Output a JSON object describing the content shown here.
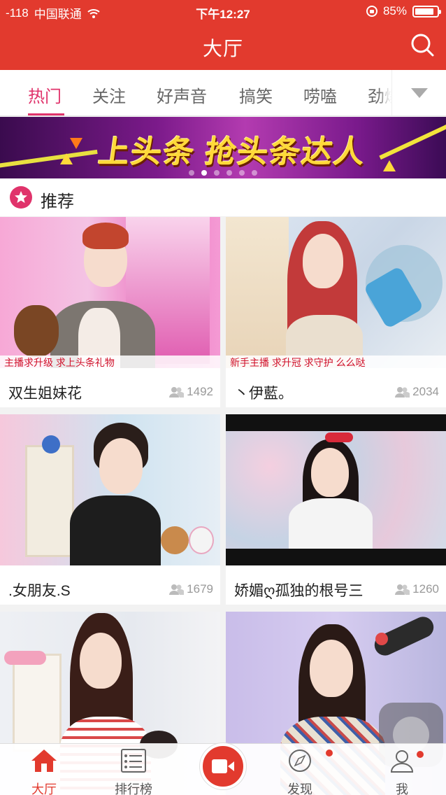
{
  "status_bar": {
    "signal": "-118",
    "carrier": "中国联通",
    "time": "下午12:27",
    "battery": "85%",
    "battery_level": 0.85
  },
  "nav": {
    "title": "大厅",
    "search_icon": "search-icon"
  },
  "tabs": [
    {
      "label": "热门",
      "active": true
    },
    {
      "label": "关注"
    },
    {
      "label": "好声音"
    },
    {
      "label": "搞笑"
    },
    {
      "label": "唠嗑"
    },
    {
      "label": "劲爆"
    }
  ],
  "banner": {
    "text": "上头条 抢头条达人",
    "slides": 6,
    "active_slide": 1
  },
  "section": {
    "title": "推荐",
    "icon": "star-icon"
  },
  "cards": [
    {
      "name": "双生姐妹花",
      "viewers": "1492",
      "overlay": "主播求升级  求上头条礼物"
    },
    {
      "name": "丶伊藍。",
      "viewers": "2034",
      "overlay": "新手主播  求升冠  求守护  么么哒"
    },
    {
      "name": ".女朋友.S",
      "viewers": "1679",
      "overlay": ""
    },
    {
      "name": "娇媚ღ孤独的根号三",
      "viewers": "1260",
      "overlay": ""
    },
    {
      "name": "",
      "viewers": "",
      "overlay": ""
    },
    {
      "name": "",
      "viewers": "",
      "overlay": ""
    }
  ],
  "tabbar": {
    "items": [
      {
        "label": "大厅",
        "icon": "home-icon",
        "active": true
      },
      {
        "label": "排行榜",
        "icon": "ranking-list-icon"
      },
      {
        "label": "",
        "icon": "video-camera-icon"
      },
      {
        "label": "发现",
        "icon": "compass-icon"
      },
      {
        "label": "我",
        "icon": "user-icon"
      }
    ]
  },
  "colors": {
    "brand": "#e23a2e",
    "accent": "#e0336b"
  }
}
